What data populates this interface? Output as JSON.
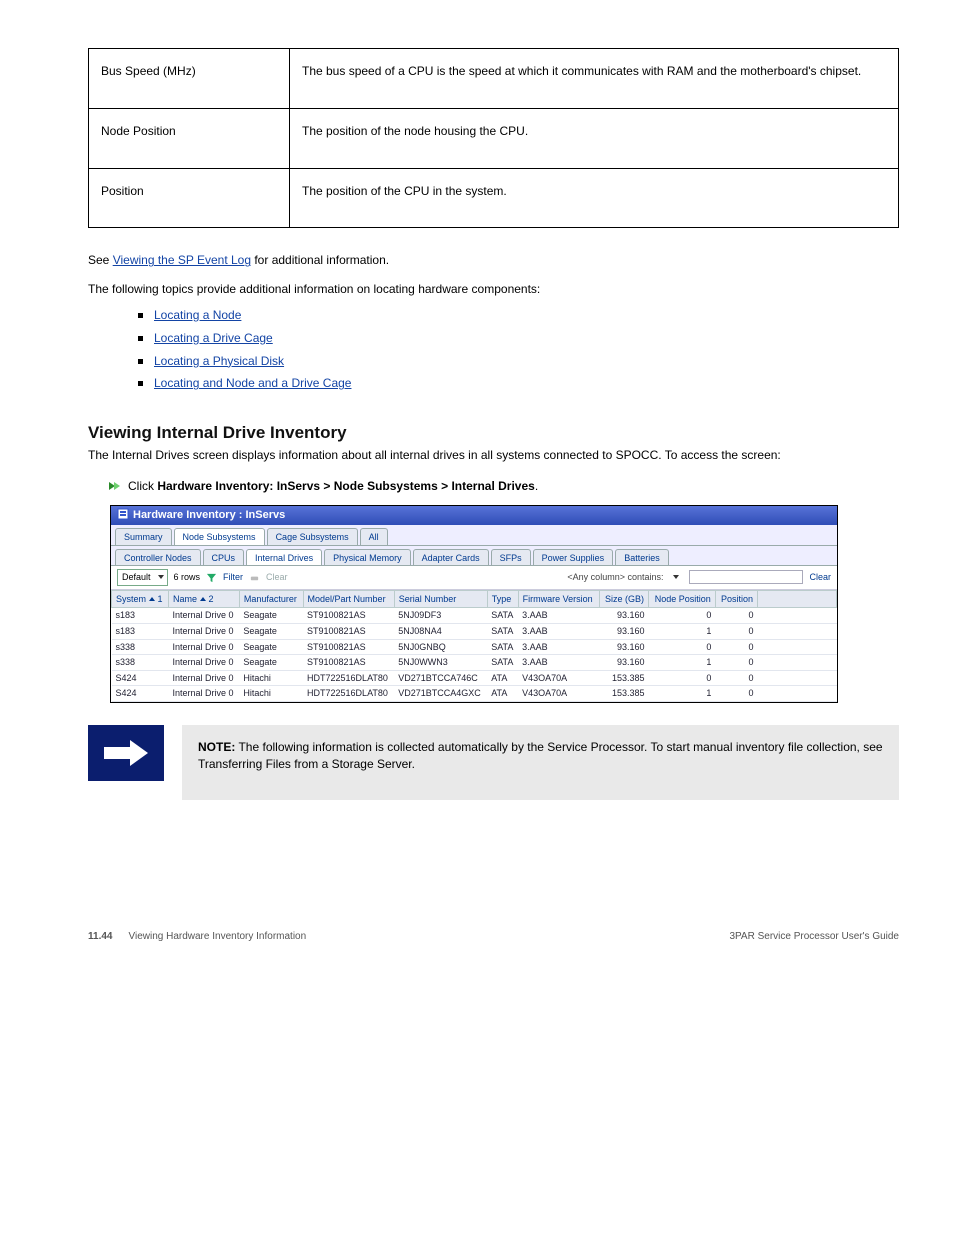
{
  "defs": [
    {
      "term": "Bus Speed (MHz)",
      "desc": "The bus speed of a CPU is the speed at which it communicates with RAM and the motherboard's chipset."
    },
    {
      "term": "Node Position",
      "desc": "The position of the node housing the CPU."
    },
    {
      "term": "Position",
      "desc": "The position of the CPU in the system."
    }
  ],
  "top_link": {
    "pre": "See ",
    "text": "Viewing the SP Event Log",
    "suf": " for additional information."
  },
  "top_para": "The following topics provide additional information on locating hardware components:",
  "ladder": [
    {
      "text": "Locating a Node",
      "href": "#"
    },
    {
      "text": "Locating a Drive Cage",
      "href": "#"
    },
    {
      "text": "Locating a Physical Disk",
      "href": "#"
    },
    {
      "text": "Locating and Node and a Drive Cage",
      "href": "#"
    }
  ],
  "h2": "Viewing Internal Drive Inventory",
  "body": "The Internal Drives screen displays information about all internal drives in all systems connected to SPOCC. To access the screen:",
  "step": {
    "pre": "Click ",
    "b": "Hardware Inventory: InServs > Node Subsystems > Internal Drives",
    "suf": "."
  },
  "ss": {
    "title": "Hardware Inventory : InServs",
    "tabs_top": [
      {
        "label": "Summary",
        "sel": false
      },
      {
        "label": "Node Subsystems",
        "sel": true
      },
      {
        "label": "Cage Subsystems",
        "sel": false
      },
      {
        "label": "All",
        "sel": false
      }
    ],
    "tabs_sub": [
      {
        "label": "Controller Nodes",
        "sel": false
      },
      {
        "label": "CPUs",
        "sel": false
      },
      {
        "label": "Internal Drives",
        "sel": true
      },
      {
        "label": "Physical Memory",
        "sel": false
      },
      {
        "label": "Adapter Cards",
        "sel": false
      },
      {
        "label": "SFPs",
        "sel": false
      },
      {
        "label": "Power Supplies",
        "sel": false
      },
      {
        "label": "Batteries",
        "sel": false
      }
    ],
    "toolbar": {
      "dropdown": "Default",
      "rows": "6 rows",
      "filter": "Filter",
      "clear": "Clear",
      "anycol": "<Any column> contains:",
      "clear2": "Clear"
    },
    "cols": [
      "System",
      "Name",
      "Manufacturer",
      "Model/Part Number",
      "Serial Number",
      "Type",
      "Firmware Version",
      "Size (GB)",
      "Node Position",
      "Position"
    ],
    "rows": [
      {
        "system": "s183",
        "name": "Internal Drive 0",
        "mfr": "Seagate",
        "model": "ST9100821AS",
        "serial": "5NJ09DF3",
        "type": "SATA",
        "fw": "3.AAB",
        "size": "93.160",
        "np": "0",
        "pos": "0"
      },
      {
        "system": "s183",
        "name": "Internal Drive 0",
        "mfr": "Seagate",
        "model": "ST9100821AS",
        "serial": "5NJ08NA4",
        "type": "SATA",
        "fw": "3.AAB",
        "size": "93.160",
        "np": "1",
        "pos": "0"
      },
      {
        "system": "s338",
        "name": "Internal Drive 0",
        "mfr": "Seagate",
        "model": "ST9100821AS",
        "serial": "5NJ0GNBQ",
        "type": "SATA",
        "fw": "3.AAB",
        "size": "93.160",
        "np": "0",
        "pos": "0"
      },
      {
        "system": "s338",
        "name": "Internal Drive 0",
        "mfr": "Seagate",
        "model": "ST9100821AS",
        "serial": "5NJ0WWN3",
        "type": "SATA",
        "fw": "3.AAB",
        "size": "93.160",
        "np": "1",
        "pos": "0"
      },
      {
        "system": "S424",
        "name": "Internal Drive 0",
        "mfr": "Hitachi",
        "model": "HDT722516DLAT80",
        "serial": "VD271BTCCA746C",
        "type": "ATA",
        "fw": "V43OA70A",
        "size": "153.385",
        "np": "0",
        "pos": "0"
      },
      {
        "system": "S424",
        "name": "Internal Drive 0",
        "mfr": "Hitachi",
        "model": "HDT722516DLAT80",
        "serial": "VD271BTCCA4GXC",
        "type": "ATA",
        "fw": "V43OA70A",
        "size": "153.385",
        "np": "1",
        "pos": "0"
      }
    ]
  },
  "note": {
    "head": "NOTE:",
    "body": "The following information is collected automatically by the Service Processor. To start manual inventory file collection, see "
  },
  "note_link": "Transferring Files from a Storage Server",
  "footer": {
    "page": "11.44",
    "title": "Viewing Hardware Inventory Information",
    "doc": "3PAR Service Processor User's Guide"
  }
}
